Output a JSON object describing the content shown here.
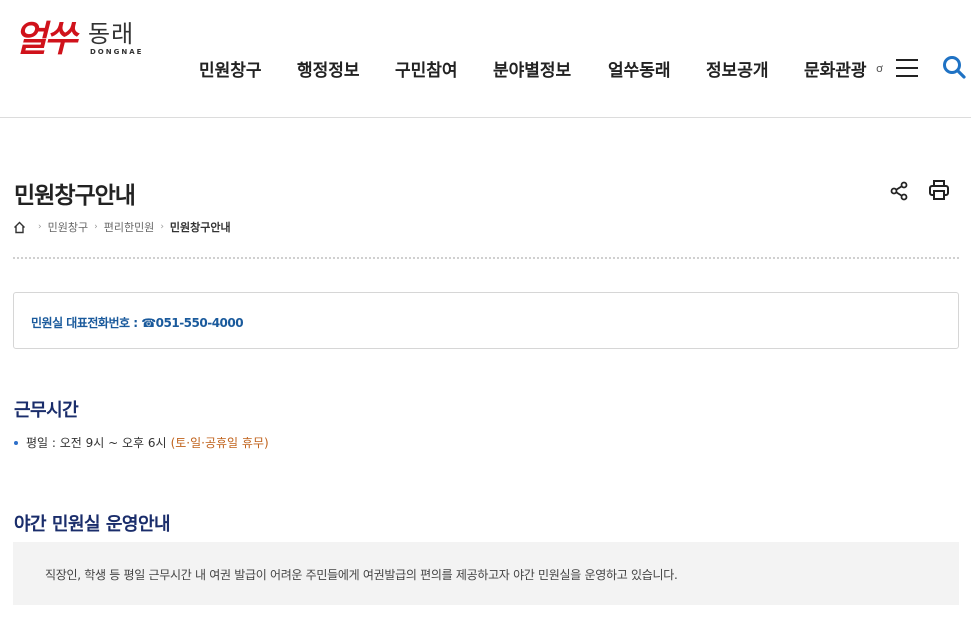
{
  "logo": {
    "script_text": "얼쑤",
    "word_text": "동래",
    "en_text": "DONGNAE"
  },
  "nav": {
    "items": [
      "민원창구",
      "행정정보",
      "구민참여",
      "분야별정보",
      "얼쑤동래",
      "정보공개",
      "문화관광"
    ],
    "util_small": "ơ"
  },
  "page": {
    "title": "민원창구안내"
  },
  "breadcrumb": {
    "items": [
      "민원창구",
      "편리한민원",
      "민원창구안내"
    ]
  },
  "phone": {
    "label": "민원실 대표전화번호 : ☎051-550-4000"
  },
  "work_hours": {
    "heading": "근무시간",
    "line_main": "평일 : 오전 9시 ~ 오후 6시",
    "line_note": "(토·일·공휴일 휴무)"
  },
  "night": {
    "heading": "야간 민원실 운영안내",
    "description": "직장인, 학생 등 평일 근무시간 내 여권 발급이 어려운 주민들에게 여권발급의 편의를 제공하고자 야간 민원실을 운영하고 있습니다."
  },
  "colors": {
    "brand_red": "#d0121b",
    "heading_navy": "#1a2d6b",
    "link_blue": "#1a5a9c",
    "accent_orange": "#c0621b"
  }
}
